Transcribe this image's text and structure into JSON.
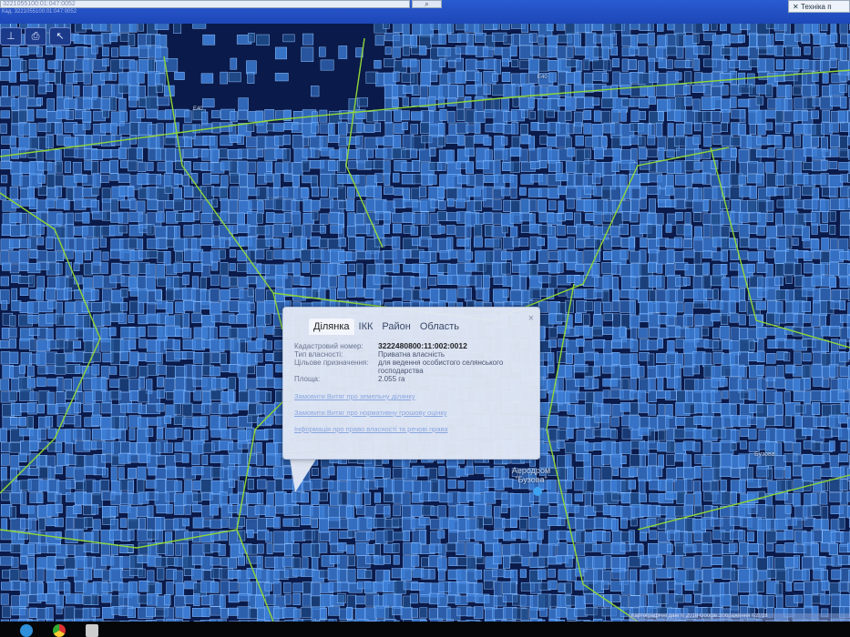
{
  "topbar": {
    "search_value": "3221055100:01:047:0052",
    "search_hint": "Кад. 3221055100:01:047:0052",
    "search_icon": "search-icon",
    "tech_button": "Техніка п"
  },
  "toolbar": {
    "tools": [
      "layers-icon",
      "print-icon",
      "pointer-icon"
    ]
  },
  "map": {
    "labels": {
      "road": "E40",
      "road2": "E40",
      "aerodrome": "Аеродром \"Бузова\"",
      "village": "Бузова"
    },
    "colors": {
      "parcel": "#3d7fd8",
      "boundary": "#8fd63a",
      "base": "#0a1a4a"
    }
  },
  "popup": {
    "tabs": [
      "Ділянка",
      "ІКК",
      "Район",
      "Область"
    ],
    "active_tab": "Ділянка",
    "close": "×",
    "fields": [
      {
        "label": "Кадастровий номер:",
        "value": "3222480800:11:002:0012"
      },
      {
        "label": "Тип власності:",
        "value": "Приватна власність"
      },
      {
        "label": "Цільове призначення:",
        "value": "для ведення особистого селянського господарства"
      },
      {
        "label": "Площа:",
        "value": "2.055 га"
      }
    ],
    "links": [
      "Замовити Витяг про земельну ділянку",
      "Замовити Витяг про нормативну грошову оцінку",
      "Інформація про право власності та речові права"
    ]
  },
  "attribution": "Картографічні дані © 2018 Google Зображення ©2018"
}
